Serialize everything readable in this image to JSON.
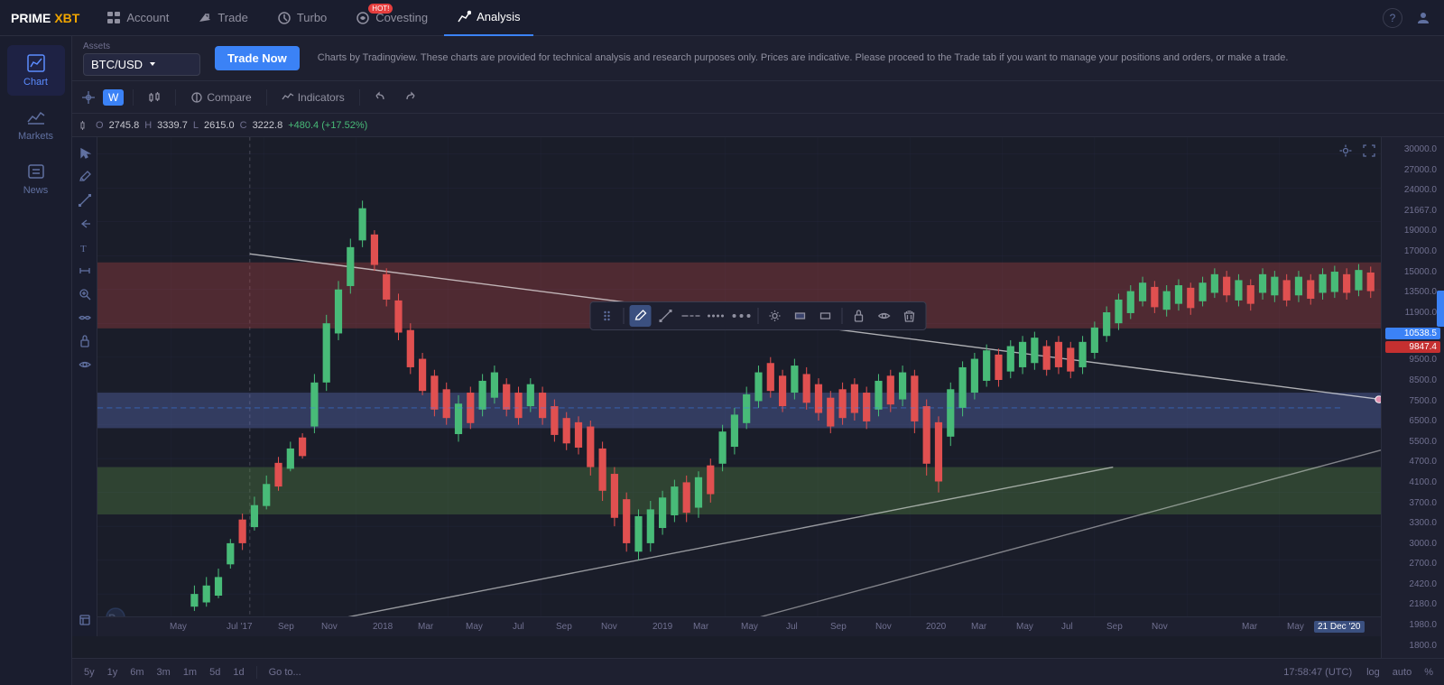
{
  "logo": {
    "prime": "PRIME",
    "xbt": "XBT"
  },
  "nav": {
    "items": [
      {
        "id": "account",
        "label": "Account",
        "icon": "account",
        "active": false
      },
      {
        "id": "trade",
        "label": "Trade",
        "icon": "trade",
        "active": false
      },
      {
        "id": "turbo",
        "label": "Turbo",
        "icon": "turbo",
        "active": false
      },
      {
        "id": "covesting",
        "label": "Covesting",
        "icon": "covesting",
        "active": false,
        "badge": "HOT!"
      },
      {
        "id": "analysis",
        "label": "Analysis",
        "icon": "analysis",
        "active": true
      }
    ]
  },
  "sidebar": {
    "items": [
      {
        "id": "chart",
        "label": "Chart",
        "active": true
      },
      {
        "id": "markets",
        "label": "Markets",
        "active": false
      },
      {
        "id": "news",
        "label": "News",
        "active": false
      }
    ]
  },
  "asset": {
    "label": "Assets",
    "selected": "BTC/USD"
  },
  "trade_button": "Trade Now",
  "info_text": "Charts by Tradingview. These charts are provided for technical analysis and research purposes only. Prices are indicative. Please proceed to the Trade tab if you want to manage your positions and orders, or make a trade.",
  "chart_toolbar": {
    "timeframe": "W",
    "compare_label": "Compare",
    "indicators_label": "Indicators"
  },
  "ohlc": {
    "open_label": "O",
    "open_val": "2745.8",
    "high_label": "H",
    "high_val": "3339.7",
    "low_label": "L",
    "low_val": "2615.0",
    "close_label": "C",
    "close_val": "3222.8",
    "change": "+480.4 (+17.52%)"
  },
  "price_scale": {
    "labels": [
      "30000.0",
      "27000.0",
      "24000.0",
      "21667.0",
      "19000.0",
      "17000.0",
      "15000.0",
      "13500.0",
      "11900.0",
      "10538.5",
      "9847.4",
      "9500.0",
      "8500.0",
      "7500.0",
      "6500.0",
      "5500.0",
      "4700.0",
      "4100.0",
      "3700.0",
      "3300.0",
      "3000.0",
      "2700.0",
      "2420.0",
      "2180.0",
      "1980.0",
      "1800.0"
    ],
    "current_price": "9847.4",
    "highlight_price": "10538.5"
  },
  "time_axis": {
    "labels": [
      "May",
      "Jul '17",
      "Sep",
      "Nov",
      "2018",
      "Mar",
      "May",
      "Jul",
      "Sep",
      "Nov",
      "2019",
      "Mar",
      "May",
      "Jul",
      "Sep",
      "Nov",
      "2020",
      "Mar",
      "May",
      "Jul",
      "Sep",
      "Nov",
      "Mar",
      "May"
    ],
    "highlighted_date": "21 Dec '20"
  },
  "bottom_bar": {
    "timeframes": [
      "5y",
      "1y",
      "6m",
      "3m",
      "1m",
      "5d",
      "1d"
    ],
    "goto_label": "Go to...",
    "utc_time": "17:58:47 (UTC)",
    "log_label": "log",
    "auto_label": "auto",
    "percent_label": "%"
  },
  "drawing_toolbar": {
    "buttons": [
      "pencil",
      "line",
      "dash-line",
      "dot-line",
      "dot2",
      "gear",
      "rect-fill",
      "rect-stroke",
      "lock",
      "eye",
      "trash"
    ]
  },
  "colors": {
    "background": "#1a1d29",
    "red_zone": "rgba(180,80,80,0.35)",
    "blue_zone": "rgba(100,120,200,0.35)",
    "green_zone": "rgba(100,150,80,0.35)",
    "candle_up": "#48bb78",
    "candle_down": "#e05050",
    "price_line": "#3b82f6",
    "trendline": "rgba(255,255,255,0.7)"
  }
}
